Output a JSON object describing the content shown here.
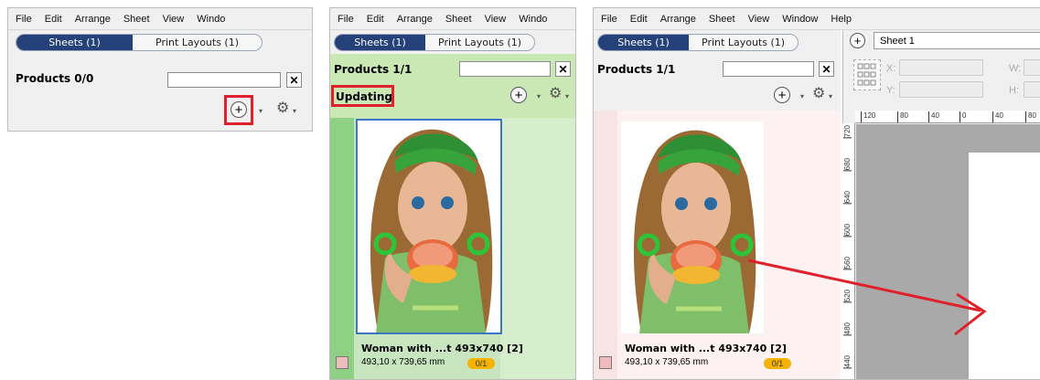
{
  "colors": {
    "menubar_bg": "#f0f0f0",
    "active_tab_bg": "#25417a",
    "highlight_red": "#e0202a",
    "updating_green": "#c9e8b4",
    "count_badge": "#f5b300",
    "canvas_gray": "#a9a9a9"
  },
  "panel1": {
    "menu": [
      "File",
      "Edit",
      "Arrange",
      "Sheet",
      "View",
      "Windo"
    ],
    "tabs": [
      "Sheets (1)",
      "Print Layouts (1)"
    ],
    "title": "Products 0/0",
    "search_value": "",
    "clear_icon": "✕",
    "add_icon": "+",
    "gear_icon": "⚙",
    "caret": "▾"
  },
  "panel2": {
    "menu": [
      "File",
      "Edit",
      "Arrange",
      "Sheet",
      "View",
      "Windo"
    ],
    "tabs": [
      "Sheets (1)",
      "Print Layouts (1)"
    ],
    "title": "Products 1/1",
    "status": "Updating",
    "item": {
      "title": "Woman with ...t 493x740 [2]",
      "size": "493,10 x 739,65 mm",
      "count": "0/1"
    }
  },
  "panel3": {
    "menu": [
      "File",
      "Edit",
      "Arrange",
      "Sheet",
      "View",
      "Window",
      "Help"
    ],
    "tabs": [
      "Sheets (1)",
      "Print Layouts (1)"
    ],
    "title": "Products 1/1",
    "sheet_name": "Sheet 1",
    "coord_labels": {
      "x": "X:",
      "y": "Y:",
      "w": "W:",
      "h": "H:"
    },
    "ruler_h": [
      "120",
      "80",
      "40",
      "0",
      "40",
      "80"
    ],
    "ruler_v": [
      "720",
      "680",
      "640",
      "600",
      "560",
      "520",
      "480",
      "440"
    ],
    "item": {
      "title": "Woman with ...t 493x740 [2]",
      "size": "493,10 x 739,65 mm",
      "count": "0/1"
    }
  }
}
